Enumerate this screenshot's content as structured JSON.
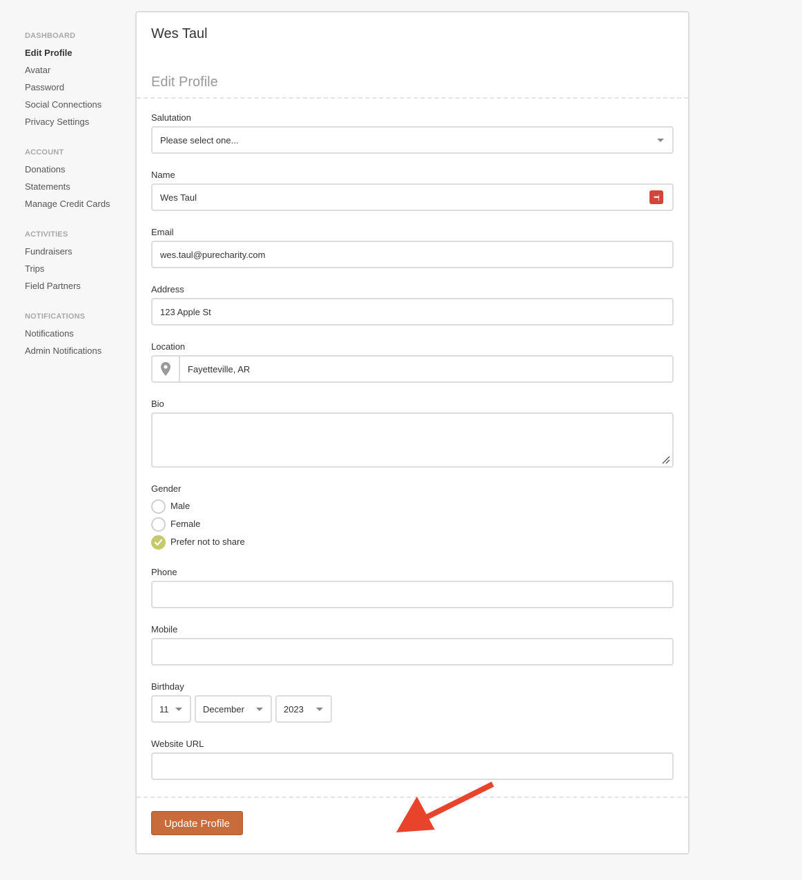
{
  "sidebar": {
    "groups": [
      {
        "heading": "DASHBOARD",
        "items": [
          "Edit Profile",
          "Avatar",
          "Password",
          "Social Connections",
          "Privacy Settings"
        ]
      },
      {
        "heading": "ACCOUNT",
        "items": [
          "Donations",
          "Statements",
          "Manage Credit Cards"
        ]
      },
      {
        "heading": "ACTIVITIES",
        "items": [
          "Fundraisers",
          "Trips",
          "Field Partners"
        ]
      },
      {
        "heading": "NOTIFICATIONS",
        "items": [
          "Notifications",
          "Admin Notifications"
        ]
      }
    ],
    "active_item": "Edit Profile"
  },
  "card": {
    "title": "Wes Taul",
    "section_title": "Edit Profile"
  },
  "form": {
    "salutation": {
      "label": "Salutation",
      "value": "Please select one..."
    },
    "name": {
      "label": "Name",
      "value": "Wes Taul"
    },
    "email": {
      "label": "Email",
      "value": "wes.taul@purecharity.com"
    },
    "address": {
      "label": "Address",
      "value": "123 Apple St"
    },
    "location": {
      "label": "Location",
      "value": "Fayetteville, AR"
    },
    "bio": {
      "label": "Bio",
      "value": ""
    },
    "gender": {
      "label": "Gender",
      "options": [
        "Male",
        "Female",
        "Prefer not to share"
      ],
      "selected": "Prefer not to share"
    },
    "phone": {
      "label": "Phone",
      "value": ""
    },
    "mobile": {
      "label": "Mobile",
      "value": ""
    },
    "birthday": {
      "label": "Birthday",
      "day": "11",
      "month": "December",
      "year": "2023"
    },
    "website": {
      "label": "Website URL",
      "value": ""
    },
    "submit_label": "Update Profile"
  },
  "colors": {
    "accent_button": "#c86c3c",
    "radio_checked": "#c6c96a",
    "annotation_arrow": "#e8432b",
    "password_manager_icon": "#d3453a"
  },
  "icons": [
    "password-manager-icon",
    "map-pin-icon",
    "resize-handle-icon",
    "checkmark-icon",
    "chevron-down-icon",
    "annotation-arrow"
  ]
}
